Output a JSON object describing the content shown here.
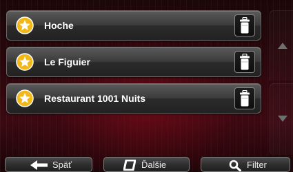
{
  "colors": {
    "star_icon_bg": "#f2b817",
    "star_icon_fg": "#ffffff",
    "text": "#ffffff",
    "background": "#2a080d"
  },
  "list": {
    "items": [
      {
        "label": "Hoche",
        "icon": "favorite-star-icon",
        "action_icon": "trash-icon"
      },
      {
        "label": "Le Figuier",
        "icon": "favorite-star-icon",
        "action_icon": "trash-icon"
      },
      {
        "label": "Restaurant 1001 Nuits",
        "icon": "favorite-star-icon",
        "action_icon": "trash-icon"
      }
    ]
  },
  "scroll": {
    "up_icon": "arrow-up-icon",
    "down_icon": "arrow-down-icon"
  },
  "footer": {
    "back_label": "Späť",
    "back_icon": "arrow-left-icon",
    "next_label": "Ďalšie",
    "next_icon": "next-icon",
    "filter_label": "Filter",
    "filter_icon": "search-icon"
  }
}
